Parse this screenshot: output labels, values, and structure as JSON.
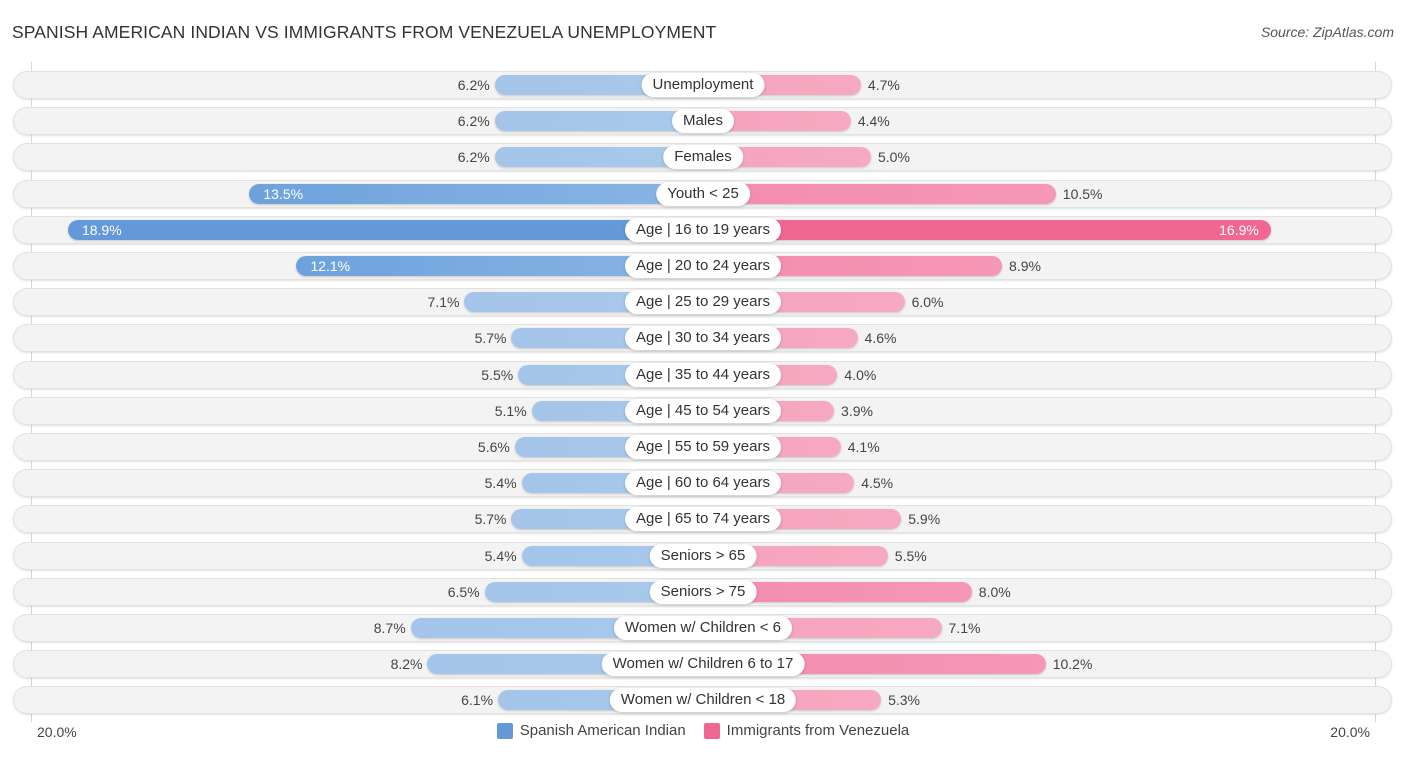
{
  "header": {
    "title": "SPANISH AMERICAN INDIAN VS IMMIGRANTS FROM VENEZUELA UNEMPLOYMENT",
    "source": "Source: ZipAtlas.com"
  },
  "colors": {
    "left_light": "#a4c5e9",
    "left_strong": "#6399d9",
    "right_light": "#f5a3bd",
    "right_strong": "#f06792"
  },
  "chart_data": {
    "type": "bar",
    "orientation": "horizontal-diverging",
    "title": "SPANISH AMERICAN INDIAN VS IMMIGRANTS FROM VENEZUELA UNEMPLOYMENT",
    "xlabel": "",
    "ylabel": "",
    "xlim": [
      -20.0,
      20.0
    ],
    "tick_labels": {
      "left": "20.0%",
      "right": "20.0%"
    },
    "legend_position": "bottom-center",
    "grid": false,
    "categories": [
      "Unemployment",
      "Males",
      "Females",
      "Youth < 25",
      "Age | 16 to 19 years",
      "Age | 20 to 24 years",
      "Age | 25 to 29 years",
      "Age | 30 to 34 years",
      "Age | 35 to 44 years",
      "Age | 45 to 54 years",
      "Age | 55 to 59 years",
      "Age | 60 to 64 years",
      "Age | 65 to 74 years",
      "Seniors > 65",
      "Seniors > 75",
      "Women w/ Children < 6",
      "Women w/ Children 6 to 17",
      "Women w/ Children < 18"
    ],
    "series": [
      {
        "name": "Spanish American Indian",
        "side": "left",
        "color": "#6399d9",
        "values": [
          6.2,
          6.2,
          6.2,
          13.5,
          18.9,
          12.1,
          7.1,
          5.7,
          5.5,
          5.1,
          5.6,
          5.4,
          5.7,
          5.4,
          6.5,
          8.7,
          8.2,
          6.1
        ],
        "labels": [
          "6.2%",
          "6.2%",
          "6.2%",
          "13.5%",
          "18.9%",
          "12.1%",
          "7.1%",
          "5.7%",
          "5.5%",
          "5.1%",
          "5.6%",
          "5.4%",
          "5.7%",
          "5.4%",
          "6.5%",
          "8.7%",
          "8.2%",
          "6.1%"
        ]
      },
      {
        "name": "Immigrants from Venezuela",
        "side": "right",
        "color": "#f06792",
        "values": [
          4.7,
          4.4,
          5.0,
          10.5,
          16.9,
          8.9,
          6.0,
          4.6,
          4.0,
          3.9,
          4.1,
          4.5,
          5.9,
          5.5,
          8.0,
          7.1,
          10.2,
          5.3
        ],
        "labels": [
          "4.7%",
          "4.4%",
          "5.0%",
          "10.5%",
          "16.9%",
          "8.9%",
          "6.0%",
          "4.6%",
          "4.0%",
          "3.9%",
          "4.1%",
          "4.5%",
          "5.9%",
          "5.5%",
          "8.0%",
          "7.1%",
          "10.2%",
          "5.3%"
        ]
      }
    ]
  }
}
